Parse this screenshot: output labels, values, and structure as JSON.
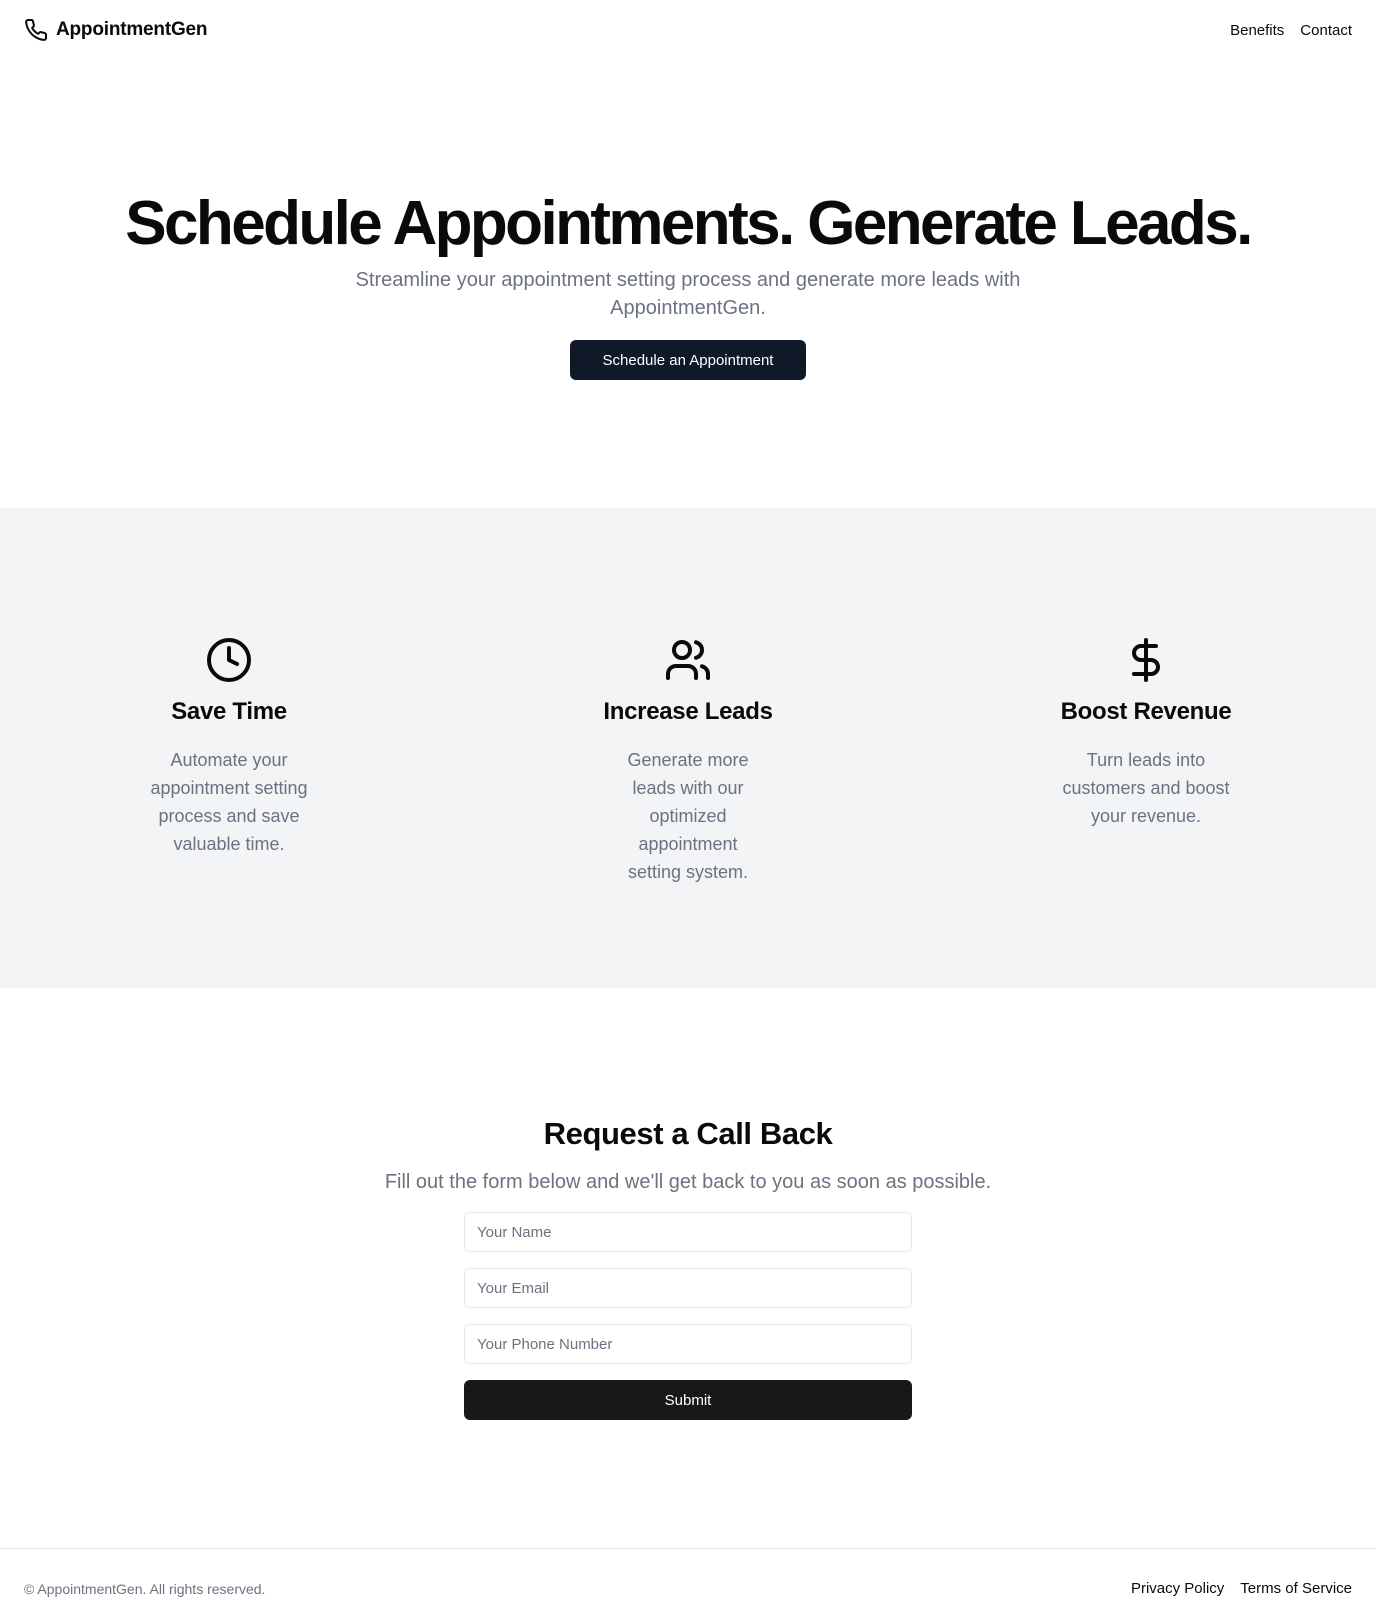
{
  "header": {
    "brand_name": "AppointmentGen",
    "brand_icon": "phone-icon",
    "nav": [
      "Benefits",
      "Contact"
    ]
  },
  "hero": {
    "title": "Schedule Appointments. Generate Leads.",
    "subtitle": "Streamline your appointment setting process and generate more leads with AppointmentGen.",
    "cta_label": "Schedule an Appointment"
  },
  "features": [
    {
      "icon": "clock-icon",
      "title": "Save Time",
      "description": "Automate your appointment setting process and save valuable time."
    },
    {
      "icon": "users-icon",
      "title": "Increase Leads",
      "description": "Generate more leads with our optimized appointment setting system."
    },
    {
      "icon": "dollar-icon",
      "title": "Boost Revenue",
      "description": "Turn leads into customers and boost your revenue."
    }
  ],
  "contact": {
    "title": "Request a Call Back",
    "subtitle": "Fill out the form below and we'll get back to you as soon as possible.",
    "name_placeholder": "Your Name",
    "email_placeholder": "Your Email",
    "phone_placeholder": "Your Phone Number",
    "submit_label": "Submit"
  },
  "footer": {
    "copyright": "© AppointmentGen. All rights reserved.",
    "links": [
      "Privacy Policy",
      "Terms of Service"
    ]
  },
  "colors": {
    "primary_button": "#111827",
    "submit_button": "#18181b",
    "muted_text": "#6b7280",
    "section_bg": "#f3f4f6",
    "border": "#e5e7eb"
  }
}
